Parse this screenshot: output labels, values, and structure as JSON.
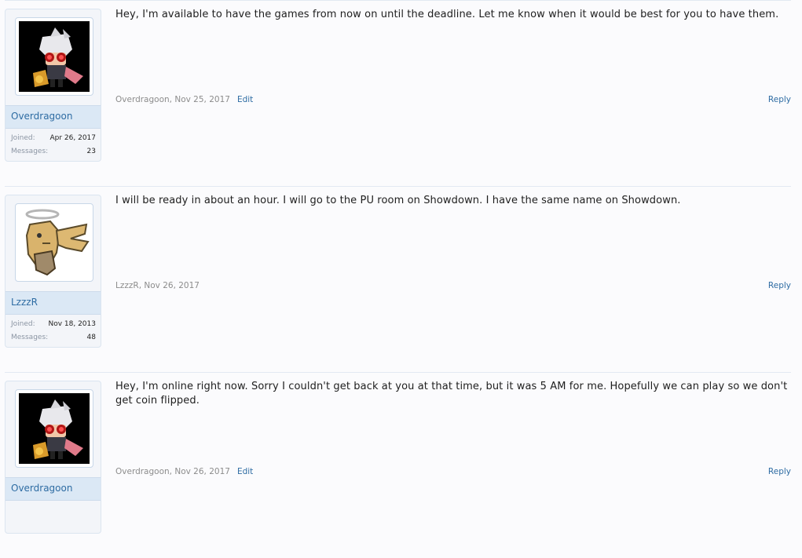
{
  "posts": [
    {
      "avatar": "overdragoon-avatar",
      "username": "Overdragoon",
      "joined_label": "Joined:",
      "joined": "Apr 26, 2017",
      "messages_label": "Messages:",
      "messages": "23",
      "message": "Hey, I'm available to have the games from now on until the deadline. Let me know when it would be best for you to have them.",
      "author": "Overdragoon",
      "date": "Nov 25, 2017",
      "edit_label": "Edit",
      "reply_label": "Reply"
    },
    {
      "avatar": "lzzzr-avatar",
      "username": "LzzzR",
      "joined_label": "Joined:",
      "joined": "Nov 18, 2013",
      "messages_label": "Messages:",
      "messages": "48",
      "message": "I will be ready in about an hour. I will go to the PU room on Showdown. I have the same name on Showdown.",
      "author": "LzzzR",
      "date": "Nov 26, 2017",
      "reply_label": "Reply"
    },
    {
      "avatar": "overdragoon-avatar",
      "username": "Overdragoon",
      "message": "Hey, I'm online right now. Sorry I couldn't get back at you at that time, but it was 5 AM for me. Hopefully we can play so we don't get coin flipped.",
      "author": "Overdragoon",
      "date": "Nov 26, 2017",
      "edit_label": "Edit",
      "reply_label": "Reply"
    }
  ],
  "meta_separator": ","
}
